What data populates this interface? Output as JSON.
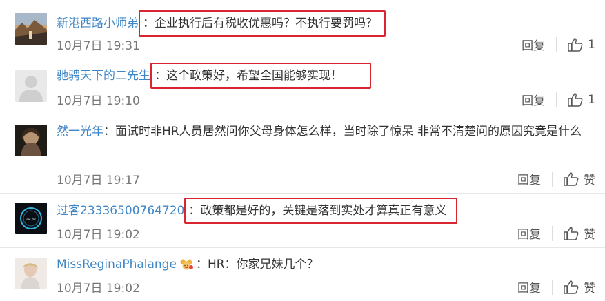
{
  "comments": [
    {
      "user": "新港西路小师弟",
      "colon": "：",
      "text": "企业执行后有税收优惠吗？不执行要罚吗？",
      "time": "10月7日 19:31",
      "reply": "回复",
      "like": "1"
    },
    {
      "user": "驰骋天下的二先生",
      "colon": "：",
      "text": "这个政策好，希望全国能够实现！",
      "time": "10月7日 19:10",
      "reply": "回复",
      "like": "1"
    },
    {
      "user": "然一光年",
      "colon": "：",
      "text": "面试时非HR人员居然问你父母身体怎么样，当时除了惊呆 非常不清楚问的原因究竟是什么",
      "time": "10月7日 19:17",
      "reply": "回复",
      "like": "赞"
    },
    {
      "user": "过客23336500764720",
      "colon": "：",
      "text": "政策都是好的，关键是落到实处才算真正有意义",
      "time": "10月7日 19:02",
      "reply": "回复",
      "like": "赞"
    },
    {
      "user": "MissReginaPhalange",
      "colon": "：",
      "text": "HR：你家兄妹几个？",
      "time": "10月7日 19:02",
      "reply": "回复",
      "like": "赞"
    }
  ],
  "colors": {
    "username": "#3f86c6",
    "highlight_box": "#d9252f",
    "meta": "#777777"
  },
  "icons": [
    "thumb-up-icon",
    "crown-emoji-icon"
  ]
}
